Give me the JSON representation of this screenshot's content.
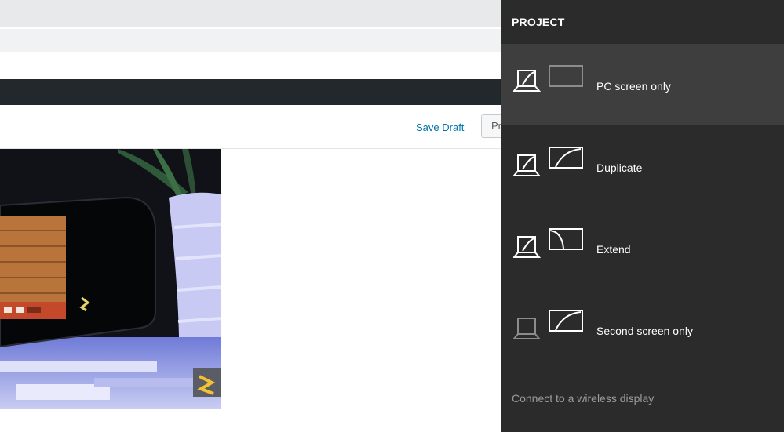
{
  "editor": {
    "save_draft_label": "Save Draft",
    "preview_label_partial": "Pr"
  },
  "project_panel": {
    "title": "PROJECT",
    "options": [
      {
        "label": "PC screen only",
        "icon": "pc-screen-only-icon",
        "selected": true
      },
      {
        "label": "Duplicate",
        "icon": "duplicate-icon",
        "selected": false
      },
      {
        "label": "Extend",
        "icon": "extend-icon",
        "selected": false
      },
      {
        "label": "Second screen only",
        "icon": "second-screen-only-icon",
        "selected": false
      }
    ],
    "wireless_link": "Connect to a wireless display"
  },
  "colors": {
    "panel_bg": "#2b2b2b",
    "selected_bg": "#3e3e3e",
    "link_blue": "#0073aa",
    "admin_bar": "#23282d"
  }
}
